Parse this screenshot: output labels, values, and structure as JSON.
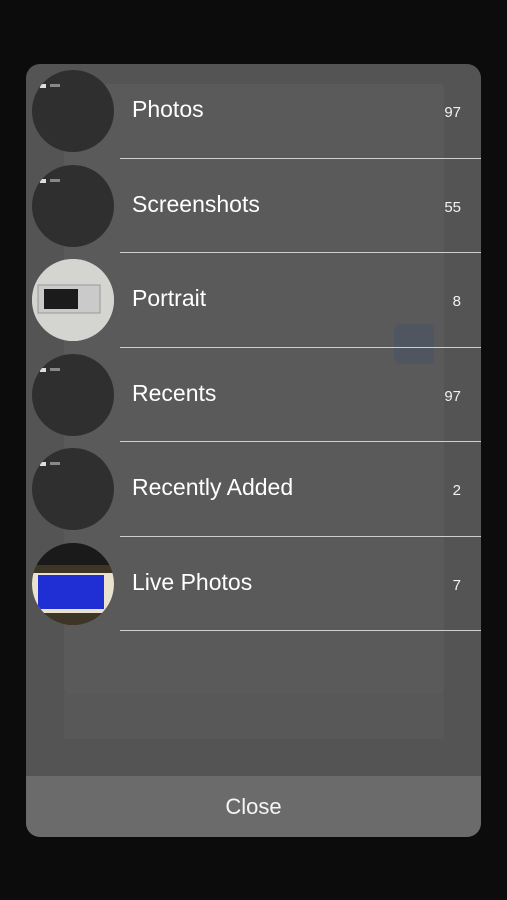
{
  "albums": [
    {
      "name": "Photos",
      "count": "97",
      "thumb": "screenshot"
    },
    {
      "name": "Screenshots",
      "count": "55",
      "thumb": "screenshot"
    },
    {
      "name": "Portrait",
      "count": "8",
      "thumb": "device"
    },
    {
      "name": "Recents",
      "count": "97",
      "thumb": "screenshot"
    },
    {
      "name": "Recently Added",
      "count": "2",
      "thumb": "screenshot"
    },
    {
      "name": "Live Photos",
      "count": "7",
      "thumb": "bluescreen"
    }
  ],
  "close_label": "Close",
  "colors": {
    "sheet": "#545454",
    "close_bar": "#6b6b6b",
    "separator": "#cfcfcf"
  }
}
